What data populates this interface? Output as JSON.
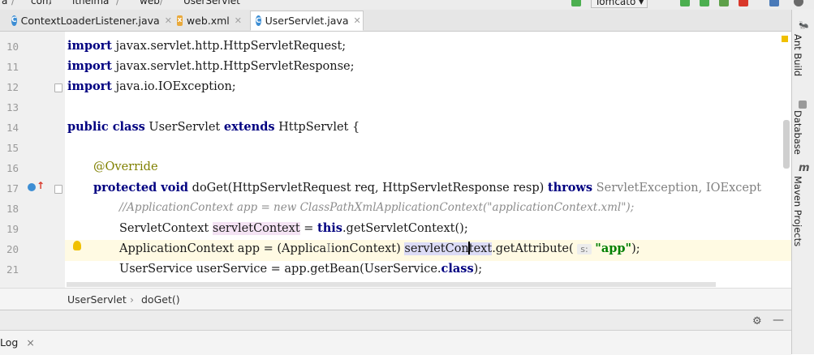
{
  "nav": {
    "crumbs": [
      "a",
      "com",
      "itheima",
      "web",
      "UserServlet"
    ],
    "run_config": "Tomcato"
  },
  "tabs": [
    {
      "label": "ContextLoaderListener.java",
      "icon": "C",
      "active": false
    },
    {
      "label": "web.xml",
      "icon": "xml",
      "active": false
    },
    {
      "label": "UserServlet.java",
      "icon": "C",
      "active": true
    }
  ],
  "editor": {
    "line_numbers": [
      "10",
      "11",
      "12",
      "13",
      "14",
      "15",
      "16",
      "17",
      "18",
      "19",
      "20",
      "21"
    ],
    "lines": {
      "l10_kw": "import",
      "l10_rest": " javax.servlet.http.HttpServletRequest;",
      "l11_kw": "import",
      "l11_rest": " javax.servlet.http.HttpServletResponse;",
      "l12_kw": "import",
      "l12_rest": " java.io.IOException;",
      "l14_kw1": "public class",
      "l14_mid": " UserServlet ",
      "l14_kw2": "extends",
      "l14_rest": " HttpServlet {",
      "l16_ann": "@Override",
      "l17_kw": "protected void",
      "l17_mid": " doGet(HttpServletRequest req, HttpServletResponse resp) ",
      "l17_kw2": "throws",
      "l17_rest": " ServletException, IOExcept",
      "l18_cm": "//ApplicationContext app = new ClassPathXmlApplicationContext(\"applicationContext.xml\");",
      "l19_a": "ServletContext ",
      "l19_var": "servletContext",
      "l19_b": " = ",
      "l19_kw": "this",
      "l19_c": ".getServletContext();",
      "l20_a": "ApplicationContext app = (Applica",
      "l20_b": "ionContext) ",
      "l20_var1": "servletCon",
      "l20_var2": "text",
      "l20_c": ".getAttribute(",
      "l20_hint": "s:",
      "l20_str": "\"app\"",
      "l20_d": ");",
      "l21_a": "UserService userService = app.getBean(UserService.",
      "l21_kw": "class",
      "l21_b": ");"
    }
  },
  "footer_crumbs": {
    "class": "UserServlet",
    "sep": "›",
    "method": "doGet()"
  },
  "bottom": {
    "log_tab": "Log",
    "close": "×"
  },
  "right_tools": [
    "Ant Build",
    "Database",
    "Maven Projects"
  ],
  "colors": {
    "keyword": "#000080",
    "annotation": "#808000",
    "string": "#008000",
    "comment": "#8c8c8c"
  }
}
